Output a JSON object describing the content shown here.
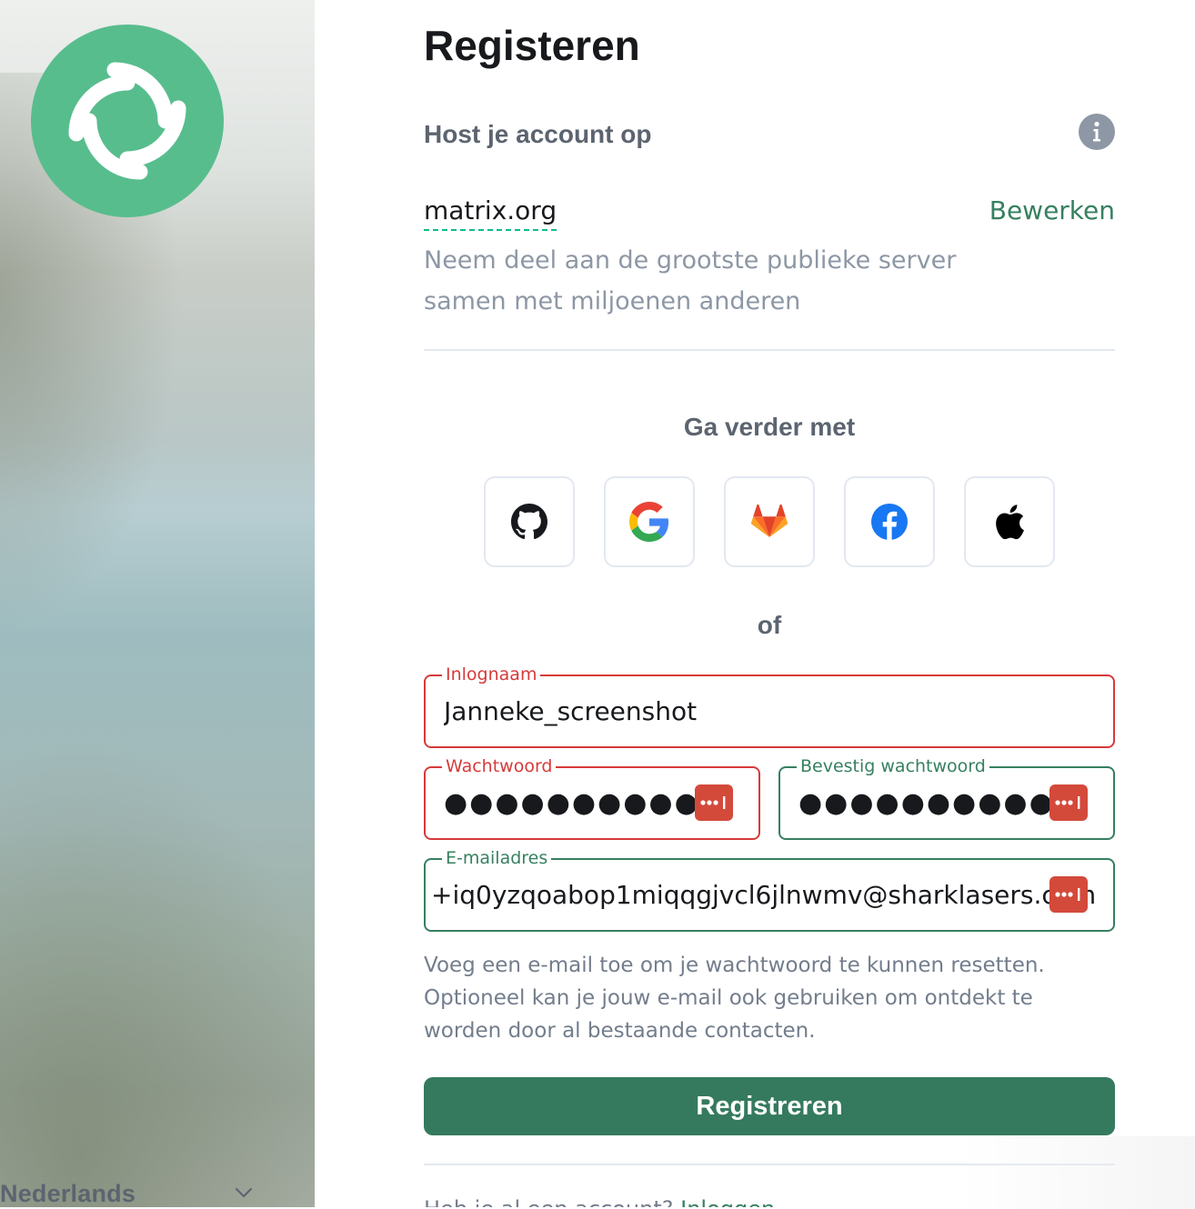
{
  "sidebar": {
    "logo_icon": "element-logo-icon",
    "language": "Nederlands",
    "language_chevron_icon": "chevron-down-icon"
  },
  "form": {
    "title": "Registeren",
    "host_label": "Host je account op",
    "info_icon": "info-icon",
    "server_name": "matrix.org",
    "edit_label": "Bewerken",
    "server_description": "Neem deel aan de grootste publieke server samen met miljoenen anderen",
    "continue_label": "Ga verder met",
    "sso_providers": [
      {
        "name": "GitHub",
        "icon": "github-icon"
      },
      {
        "name": "Google",
        "icon": "google-icon"
      },
      {
        "name": "GitLab",
        "icon": "gitlab-icon"
      },
      {
        "name": "Facebook",
        "icon": "facebook-icon"
      },
      {
        "name": "Apple",
        "icon": "apple-icon"
      }
    ],
    "or_label": "of",
    "username": {
      "label": "Inlognaam",
      "value": "Janneke_screenshot"
    },
    "password": {
      "label": "Wachtwoord",
      "masked": "●●●●●●●●●●●"
    },
    "confirm_password": {
      "label": "Bevestig wachtwoord",
      "masked": "●●●●●●●●●●●"
    },
    "email": {
      "label": "E-mailadres",
      "value": "+iq0yzqoabop1miqqgjvcl6jlnwmv@sharklasers.com"
    },
    "help_text": "Voeg een e-mail toe om je wachtwoord te kunnen resetten. Optioneel kan je jouw e-mail ook gebruiken om ontdekt te worden door al bestaande contacten.",
    "submit_label": "Registreren",
    "footer_text": "Heb je al een account?",
    "footer_link": "Inloggen"
  },
  "colors": {
    "accent": "#368060",
    "error": "#d63a3a",
    "logo": "#58bd8d",
    "password_manager": "#d34a3b"
  }
}
